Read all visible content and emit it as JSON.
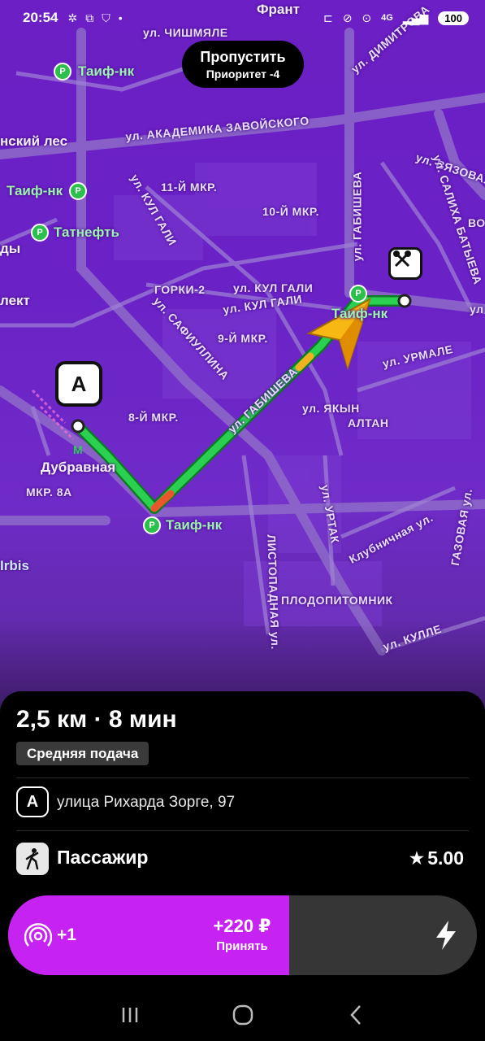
{
  "status_bar": {
    "time": "20:54",
    "network": "4G",
    "battery": "100",
    "icons_left": [
      "fan-icon",
      "screenshot-icon",
      "shield-icon",
      "dot-icon"
    ],
    "icons_right": [
      "bed-icon",
      "mute-icon",
      "location-icon",
      "network-icon",
      "signal-icon"
    ]
  },
  "skip_button": {
    "label": "Пропустить",
    "priority": "Приоритет -4"
  },
  "map": {
    "labels": {
      "top_street": "ул. ЧИШМЯЛЕ",
      "frant": "Франт",
      "dimitrova": "ул. ДИМИТРОВА",
      "taif1": "Таиф-нк",
      "forest": "нский лес",
      "zavoisky": "ул. АКАДЕМИКА ЗАВОЙСКОГО",
      "taif2": "Таиф-нк",
      "mkr11": "11-Й МКР.",
      "kul_gali_v": "ул. КУЛ ГАЛИ",
      "mkr10": "10-Й МКР.",
      "gabisheva_v": "ул. ГАБИШЕВА",
      "vyazovaya": "ул. ВЯЗОВАЯ",
      "satikha": "ул. САЛИХА БАТЫЕВА",
      "tatneft": "Татнефть",
      "ekt": "лект",
      "dy": "ды",
      "gorki": "ГОРКИ-2",
      "kul_gali1": "ул. КУЛ ГАЛИ",
      "kul_gali2": "ул. КУЛ ГАЛИ",
      "safiullina": "ул. САФИУЛЛИНА",
      "mkr9": "9-Й МКР.",
      "taif3": "Таиф-нк",
      "urmale": "ул. УРМАЛЕ",
      "gabisheva_diag": "ул. ГАБИШЕВА",
      "yakyn": "ул. ЯКЫН",
      "altan": "АЛТАН",
      "mkr8": "8-Й МКР.",
      "dubravnaya": "Дубравная",
      "mkr8a": "МКР. 8А",
      "taif4": "Таиф-нк",
      "urtak": "ул. УРТАК",
      "klubnichnaya": "Клубничная ул.",
      "gazovaya": "ГАЗОВАЯ ул.",
      "irbis": "Irbis",
      "listopadnaya": "ЛИСТОПАДНАЯ ул.",
      "plodopitomnik": "ПЛОДОПИТОМНИК",
      "kulle": "ул. КУЛЛЕ",
      "vo": "ВО",
      "ul": "ул"
    },
    "marker_a": "A",
    "route_color": "#22c84a"
  },
  "trip": {
    "distance_time": "2,5 км · 8 мин",
    "feed_badge": "Средняя подача",
    "address_badge": "A",
    "address": "улица Рихарда Зорге, 97",
    "passenger_label": "Пассажир",
    "rating": "5.00"
  },
  "accept": {
    "extra": "+1",
    "price": "+220 ₽",
    "label": "Принять",
    "fill_fraction": 0.6,
    "fill_color": "#c622f2"
  },
  "navbar": {
    "items": [
      "recents-icon",
      "home-icon",
      "back-icon"
    ]
  }
}
